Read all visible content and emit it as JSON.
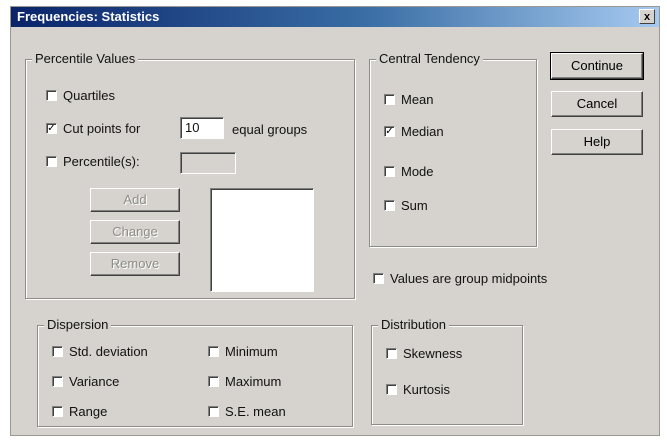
{
  "window": {
    "title": "Frequencies: Statistics",
    "close_glyph": "x"
  },
  "percentile": {
    "legend": "Percentile Values",
    "quartiles": {
      "label": "Quartiles",
      "checked": false
    },
    "cutpoints": {
      "label": "Cut points for",
      "checked": true,
      "value": "10",
      "suffix": "equal groups"
    },
    "percentiles": {
      "label": "Percentile(s):",
      "checked": false,
      "value": ""
    },
    "add_label": "Add",
    "change_label": "Change",
    "remove_label": "Remove"
  },
  "central": {
    "legend": "Central Tendency",
    "mean": {
      "label": "Mean",
      "checked": false
    },
    "median": {
      "label": "Median",
      "checked": true
    },
    "mode": {
      "label": "Mode",
      "checked": false
    },
    "sum": {
      "label": "Sum",
      "checked": false
    }
  },
  "buttons": {
    "continue": "Continue",
    "cancel": "Cancel",
    "help": "Help"
  },
  "group_midpoints": {
    "label": "Values are group midpoints",
    "checked": false
  },
  "dispersion": {
    "legend": "Dispersion",
    "std_dev": {
      "label": "Std. deviation",
      "checked": false
    },
    "variance": {
      "label": "Variance",
      "checked": false
    },
    "range": {
      "label": "Range",
      "checked": false
    },
    "minimum": {
      "label": "Minimum",
      "checked": false
    },
    "maximum": {
      "label": "Maximum",
      "checked": false
    },
    "se_mean": {
      "label": "S.E. mean",
      "checked": false
    }
  },
  "distribution": {
    "legend": "Distribution",
    "skewness": {
      "label": "Skewness",
      "checked": false
    },
    "kurtosis": {
      "label": "Kurtosis",
      "checked": false
    }
  },
  "check_mark": "✓"
}
